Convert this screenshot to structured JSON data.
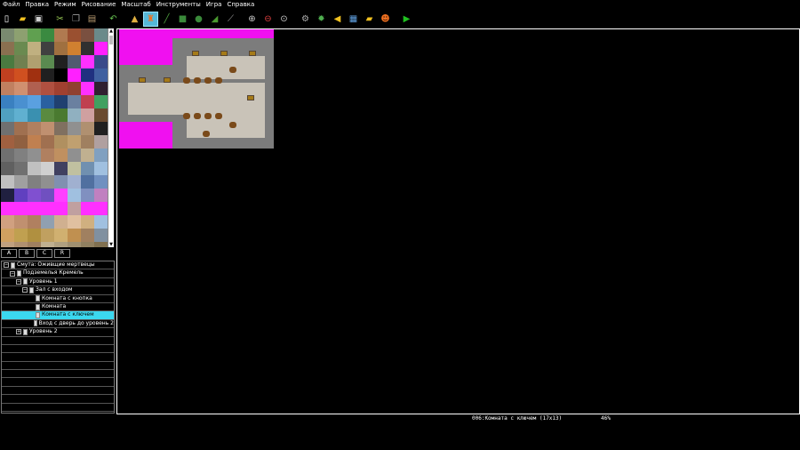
{
  "menu": [
    "Файл",
    "Правка",
    "Режим",
    "Рисование",
    "Масштаб",
    "Инструменты",
    "Игра",
    "Справка"
  ],
  "toolbar": {
    "buttons": [
      {
        "icon": "new-file-icon",
        "glyph": "▯",
        "color": "#ffffff"
      },
      {
        "icon": "open-folder-icon",
        "glyph": "▰",
        "color": "#f0c020"
      },
      {
        "icon": "save-icon",
        "glyph": "▣",
        "color": "#d0d0d0"
      },
      {
        "icon": "cut-icon",
        "glyph": "✂",
        "color": "#9acb55"
      },
      {
        "icon": "copy-icon",
        "glyph": "❐",
        "color": "#9a9a9a"
      },
      {
        "icon": "paste-icon",
        "glyph": "▤",
        "color": "#b89a70"
      },
      {
        "icon": "undo-icon",
        "glyph": "↶",
        "color": "#66c050"
      },
      {
        "icon": "terrain-icon",
        "glyph": "▲",
        "color": "#e0b040"
      },
      {
        "icon": "stamp-tool-icon",
        "glyph": "♜",
        "color": "#f07020",
        "active": true
      },
      {
        "icon": "line-tool-icon",
        "glyph": "╱",
        "color": "#50a040"
      },
      {
        "icon": "rectangle-tool-icon",
        "glyph": "■",
        "color": "#3a8a3a"
      },
      {
        "icon": "ellipse-tool-icon",
        "glyph": "●",
        "color": "#3a8a3a"
      },
      {
        "icon": "fill-tool-icon",
        "glyph": "◢",
        "color": "#4a9a30"
      },
      {
        "icon": "eyedropper-icon",
        "glyph": "⟋",
        "color": "#a0a0a0"
      },
      {
        "icon": "zoom-in-icon",
        "glyph": "⊕",
        "color": "#d0d0d0"
      },
      {
        "icon": "zoom-out-icon",
        "glyph": "⊖",
        "color": "#e04040"
      },
      {
        "icon": "zoom-fit-icon",
        "glyph": "⊙",
        "color": "#d0d0d0"
      },
      {
        "icon": "settings-gear-icon",
        "glyph": "⚙",
        "color": "#b0b0b0"
      },
      {
        "icon": "plugin-gear-icon",
        "glyph": "✹",
        "color": "#50b050"
      },
      {
        "icon": "sound-icon",
        "glyph": "◀",
        "color": "#f0c020"
      },
      {
        "icon": "picture-icon",
        "glyph": "▦",
        "color": "#60a0e0"
      },
      {
        "icon": "folder-image-icon",
        "glyph": "▰",
        "color": "#f0c020"
      },
      {
        "icon": "character-icon",
        "glyph": "☻",
        "color": "#f07020"
      },
      {
        "icon": "play-icon",
        "glyph": "▶",
        "color": "#20c020"
      }
    ]
  },
  "layer_tabs": [
    "A",
    "B",
    "C",
    "R"
  ],
  "tree": [
    {
      "label": "Смута: Оживщие мертвецы",
      "level": 0,
      "expander": "−"
    },
    {
      "label": "Подземелья Кремель",
      "level": 1,
      "expander": "−"
    },
    {
      "label": "Уровень 1",
      "level": 2,
      "expander": "−"
    },
    {
      "label": "Зал с входом",
      "level": 3,
      "expander": "−"
    },
    {
      "label": "Комната с кнопка",
      "level": 4,
      "expander": ""
    },
    {
      "label": "Комната",
      "level": 4,
      "expander": ""
    },
    {
      "label": "Комната с ключем",
      "level": 4,
      "expander": "",
      "selected": true
    },
    {
      "label": "Вход с дверь до уровень 2",
      "level": 4,
      "expander": ""
    },
    {
      "label": "Уровень 2",
      "level": 2,
      "expander": "+"
    },
    {
      "label": "",
      "level": 0,
      "expander": ""
    },
    {
      "label": "",
      "level": 0,
      "expander": ""
    },
    {
      "label": "",
      "level": 0,
      "expander": ""
    },
    {
      "label": "",
      "level": 0,
      "expander": ""
    },
    {
      "label": "",
      "level": 0,
      "expander": ""
    },
    {
      "label": "",
      "level": 0,
      "expander": ""
    },
    {
      "label": "",
      "level": 0,
      "expander": ""
    },
    {
      "label": "",
      "level": 0,
      "expander": ""
    },
    {
      "label": "",
      "level": 0,
      "expander": ""
    }
  ],
  "status": {
    "room": "006:Комната с ключем (17x13)",
    "zoom": "46%"
  },
  "colors": {
    "selection": "#3bd8ef",
    "magenta_fill": "#f010f0",
    "wall": "#7c7c7c",
    "floor": "#c9c3b8"
  }
}
